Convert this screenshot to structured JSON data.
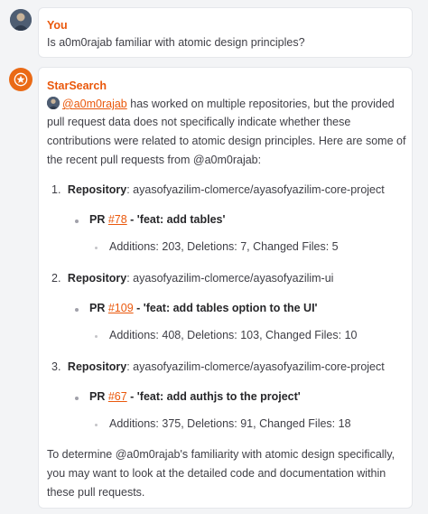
{
  "user_message": {
    "author": "You",
    "text": "Is a0m0rajab familiar with atomic design principles?"
  },
  "bot_message": {
    "author": "StarSearch",
    "intro": {
      "mention": "@a0m0rajab",
      "line1_rest": " has worked on multiple repositories, but the provided",
      "line2": "pull request data does not specifically indicate whether these",
      "line3": "contributions were related to atomic design principles. Here are some of",
      "line4": "the recent pull requests from @a0m0rajab:"
    },
    "items": [
      {
        "num": "1.",
        "repo_label": "Repository",
        "repo": ": ayasofyazilim-clomerce/ayasofyazilim-core-project",
        "pr_label": "PR ",
        "pr_link": "#78",
        "pr_title": " - 'feat: add tables'",
        "stats": "Additions: 203, Deletions: 7, Changed Files: 5"
      },
      {
        "num": "2.",
        "repo_label": "Repository",
        "repo": ": ayasofyazilim-clomerce/ayasofyazilim-ui",
        "pr_label": "PR ",
        "pr_link": "#109",
        "pr_title": " - 'feat: add tables option to the UI'",
        "stats": "Additions: 408, Deletions: 103, Changed Files: 10"
      },
      {
        "num": "3.",
        "repo_label": "Repository",
        "repo": ": ayasofyazilim-clomerce/ayasofyazilim-core-project",
        "pr_label": "PR ",
        "pr_link": "#67",
        "pr_title": " - 'feat: add authjs to the project'",
        "stats": "Additions: 375, Deletions: 91, Changed Files: 18"
      }
    ],
    "outro": {
      "line1": "To determine @a0m0rajab's familiarity with atomic design specifically,",
      "line2": "you may want to look at the detailed code and documentation within",
      "line3": "these pull requests."
    }
  },
  "colors": {
    "accent": "#ea580c",
    "background": "#f3f4f6",
    "card": "#ffffff"
  },
  "icons": {
    "user_avatar": "user-avatar",
    "bot_avatar": "starsearch-star-icon"
  }
}
